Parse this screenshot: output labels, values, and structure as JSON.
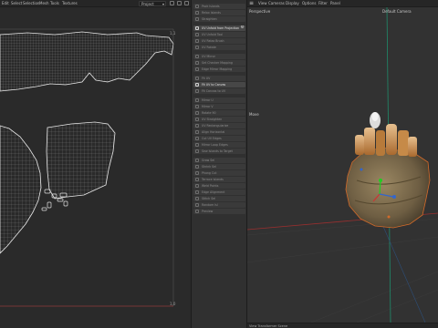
{
  "uv_editor": {
    "menu": [
      "Edit",
      "Select",
      "Selection",
      "Mesh",
      "Tools",
      "Textures"
    ],
    "mode_select": "Project"
  },
  "command_panel": {
    "groups": [
      [
        {
          "label": "Pack Islands",
          "active": false
        },
        {
          "label": "Relax Islands",
          "active": false
        },
        {
          "label": "Straighten",
          "active": false
        }
      ],
      [
        {
          "label": "UV Unfold from Projection",
          "active": true,
          "settings": true
        },
        {
          "label": "UV Unfold Tool",
          "active": false
        },
        {
          "label": "UV Relax Brush",
          "active": false
        },
        {
          "label": "UV Rotate",
          "active": false
        }
      ],
      [
        {
          "label": "UV Mirror",
          "active": false
        },
        {
          "label": "Set Checker Mapping",
          "active": false
        },
        {
          "label": "Edge Mirror Mapping",
          "active": false
        }
      ],
      [
        {
          "label": "Fit UV",
          "active": false
        },
        {
          "label": "Fit UV to Canvas",
          "active": true
        },
        {
          "label": "Fit Canvas to UV",
          "active": false
        }
      ],
      [
        {
          "label": "Mirror U",
          "active": false
        },
        {
          "label": "Mirror V",
          "active": false
        },
        {
          "label": "Rotate 90",
          "active": false
        },
        {
          "label": "UV Straighten",
          "active": false
        },
        {
          "label": "UV Rectangularize",
          "active": false
        },
        {
          "label": "Align Horizontal",
          "active": false
        },
        {
          "label": "Cut UV Edges",
          "active": false
        },
        {
          "label": "Mirror Loop Edges",
          "active": false
        },
        {
          "label": "Sew Islands to Target",
          "active": false
        }
      ],
      [
        {
          "label": "Grow Sel",
          "active": false
        },
        {
          "label": "Shrink Sel",
          "active": false
        },
        {
          "label": "Phong Cut",
          "active": false
        },
        {
          "label": "Terrace Islands",
          "active": false
        },
        {
          "label": "Weld Points",
          "active": false
        },
        {
          "label": "Edge Alignment",
          "active": false
        },
        {
          "label": "Stitch Sel",
          "active": false
        },
        {
          "label": "Random Isl",
          "active": false
        },
        {
          "label": "Preview",
          "active": false
        }
      ]
    ]
  },
  "viewport": {
    "menu": [
      "View",
      "Cameras",
      "Display",
      "Options",
      "Filter",
      "Panel"
    ],
    "name": "Perspective",
    "camera": "Default Camera",
    "footer": "View Transformer Scene",
    "move_label": "Move"
  },
  "colors": {
    "accent": "#cfa77a",
    "sack": "#7a6a4c",
    "selection": "#d26a2a",
    "axis_red": "#9a2f2f",
    "axis_green": "#1f8c6b"
  }
}
